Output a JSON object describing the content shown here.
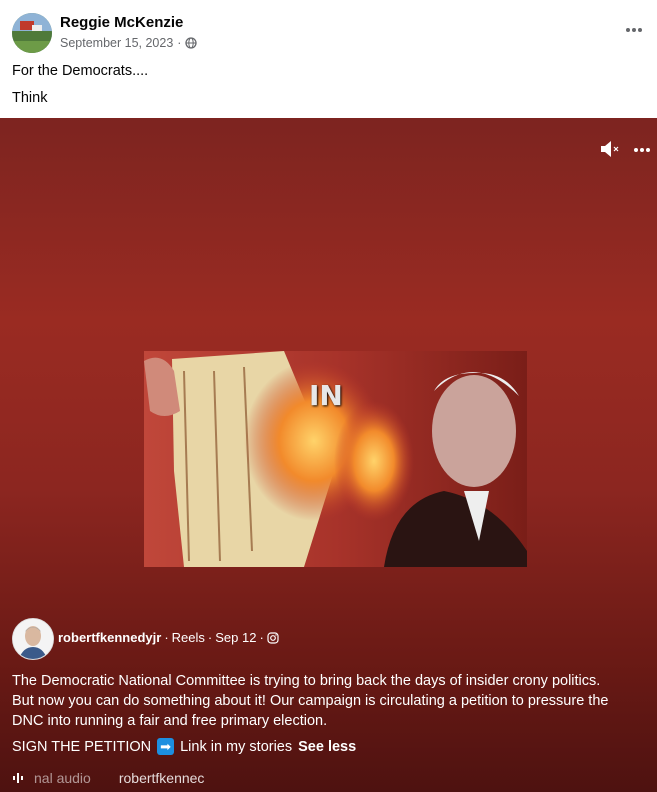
{
  "post": {
    "author": "Reggie McKenzie",
    "date": "September 15, 2023",
    "dot": "·",
    "privacy_icon": "globe-icon",
    "more_icon": "more-horizontal-icon",
    "caption_line1": "For the Democrats....",
    "caption_line2": "Think"
  },
  "reel": {
    "video_overlay_text": "IN",
    "author": "robertfkennedyjr",
    "source": "Reels",
    "date": "Sep 12",
    "sep": "·",
    "platform_icon": "instagram-icon",
    "description": "The Democratic National Committee is trying to bring back the days of insider crony politics. But now you can do something about it! Our campaign is circulating a petition to pressure the DNC into running a fair and free primary election.",
    "cta_text": "SIGN THE PETITION",
    "cta_arrow": "➡",
    "cta_link": "Link in my stories",
    "see_less": "See less",
    "audio_text": "nal audio",
    "audio_author": "robertfkennec",
    "colors": {
      "background_top": "#7d2420",
      "background_bottom": "#4e1210",
      "accent_arrow": "#1d8fe0"
    }
  }
}
